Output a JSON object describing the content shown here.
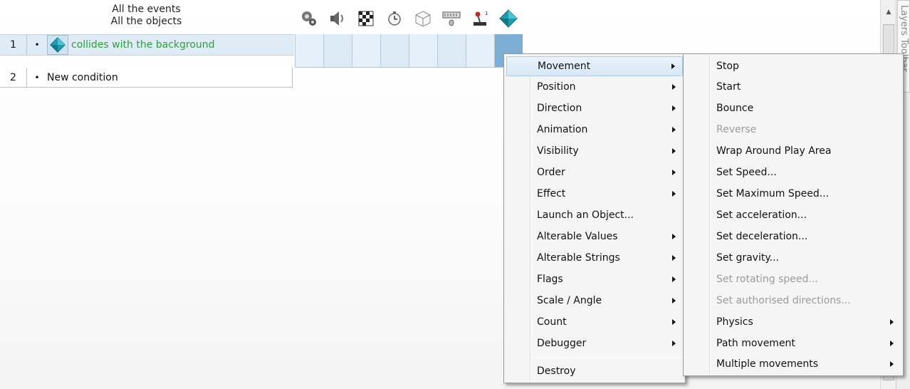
{
  "grid_header": {
    "line1": "All the events",
    "line2": "All the objects"
  },
  "object_columns": [
    {
      "name": "special-conditions-icon"
    },
    {
      "name": "sound-icon"
    },
    {
      "name": "storyboard-controls-icon"
    },
    {
      "name": "timer-icon"
    },
    {
      "name": "create-new-objects-icon"
    },
    {
      "name": "mouse-keyboard-icon"
    },
    {
      "name": "player-joystick-icon"
    },
    {
      "name": "active-object-diamond-icon"
    }
  ],
  "events": [
    {
      "number": "1",
      "bullet": "•",
      "condition": "collides with the background",
      "condition_color": "#2e9f3d"
    },
    {
      "number": "2",
      "bullet": "•",
      "condition": "New condition"
    }
  ],
  "context_menu": {
    "items": [
      {
        "label": "Movement",
        "submenu": true,
        "highlighted": true
      },
      {
        "label": "Position",
        "submenu": true
      },
      {
        "label": "Direction",
        "submenu": true
      },
      {
        "label": "Animation",
        "submenu": true
      },
      {
        "label": "Visibility",
        "submenu": true
      },
      {
        "label": "Order",
        "submenu": true
      },
      {
        "label": "Effect",
        "submenu": true
      },
      {
        "label": "Launch an Object...",
        "submenu": false
      },
      {
        "label": "Alterable Values",
        "submenu": true
      },
      {
        "label": "Alterable Strings",
        "submenu": true
      },
      {
        "label": "Flags",
        "submenu": true
      },
      {
        "label": "Scale / Angle",
        "submenu": true
      },
      {
        "label": "Count",
        "submenu": true
      },
      {
        "label": "Debugger",
        "submenu": true
      },
      {
        "label": "Destroy",
        "submenu": false
      }
    ]
  },
  "movement_submenu": {
    "items": [
      {
        "label": "Stop",
        "enabled": true
      },
      {
        "label": "Start",
        "enabled": true
      },
      {
        "label": "Bounce",
        "enabled": true
      },
      {
        "label": "Reverse",
        "enabled": false
      },
      {
        "label": "Wrap Around Play Area",
        "enabled": true
      },
      {
        "label": "Set Speed...",
        "enabled": true
      },
      {
        "label": "Set Maximum Speed...",
        "enabled": true
      },
      {
        "label": "Set acceleration...",
        "enabled": true
      },
      {
        "label": "Set deceleration...",
        "enabled": true
      },
      {
        "label": "Set gravity...",
        "enabled": true
      },
      {
        "label": "Set rotating speed...",
        "enabled": false
      },
      {
        "label": "Set authorised directions...",
        "enabled": false
      },
      {
        "label": "Physics",
        "enabled": true,
        "submenu": true
      },
      {
        "label": "Path movement",
        "enabled": true,
        "submenu": true
      },
      {
        "label": "Multiple movements",
        "enabled": true,
        "submenu": true
      }
    ]
  },
  "side_panel": {
    "label": "Layers Toolbar"
  },
  "colors": {
    "row_highlight": "#dfecf5",
    "menu_highlight": "#d7e8f6",
    "disabled_text": "#9b9b9b",
    "diamond": "#1f9db0"
  }
}
